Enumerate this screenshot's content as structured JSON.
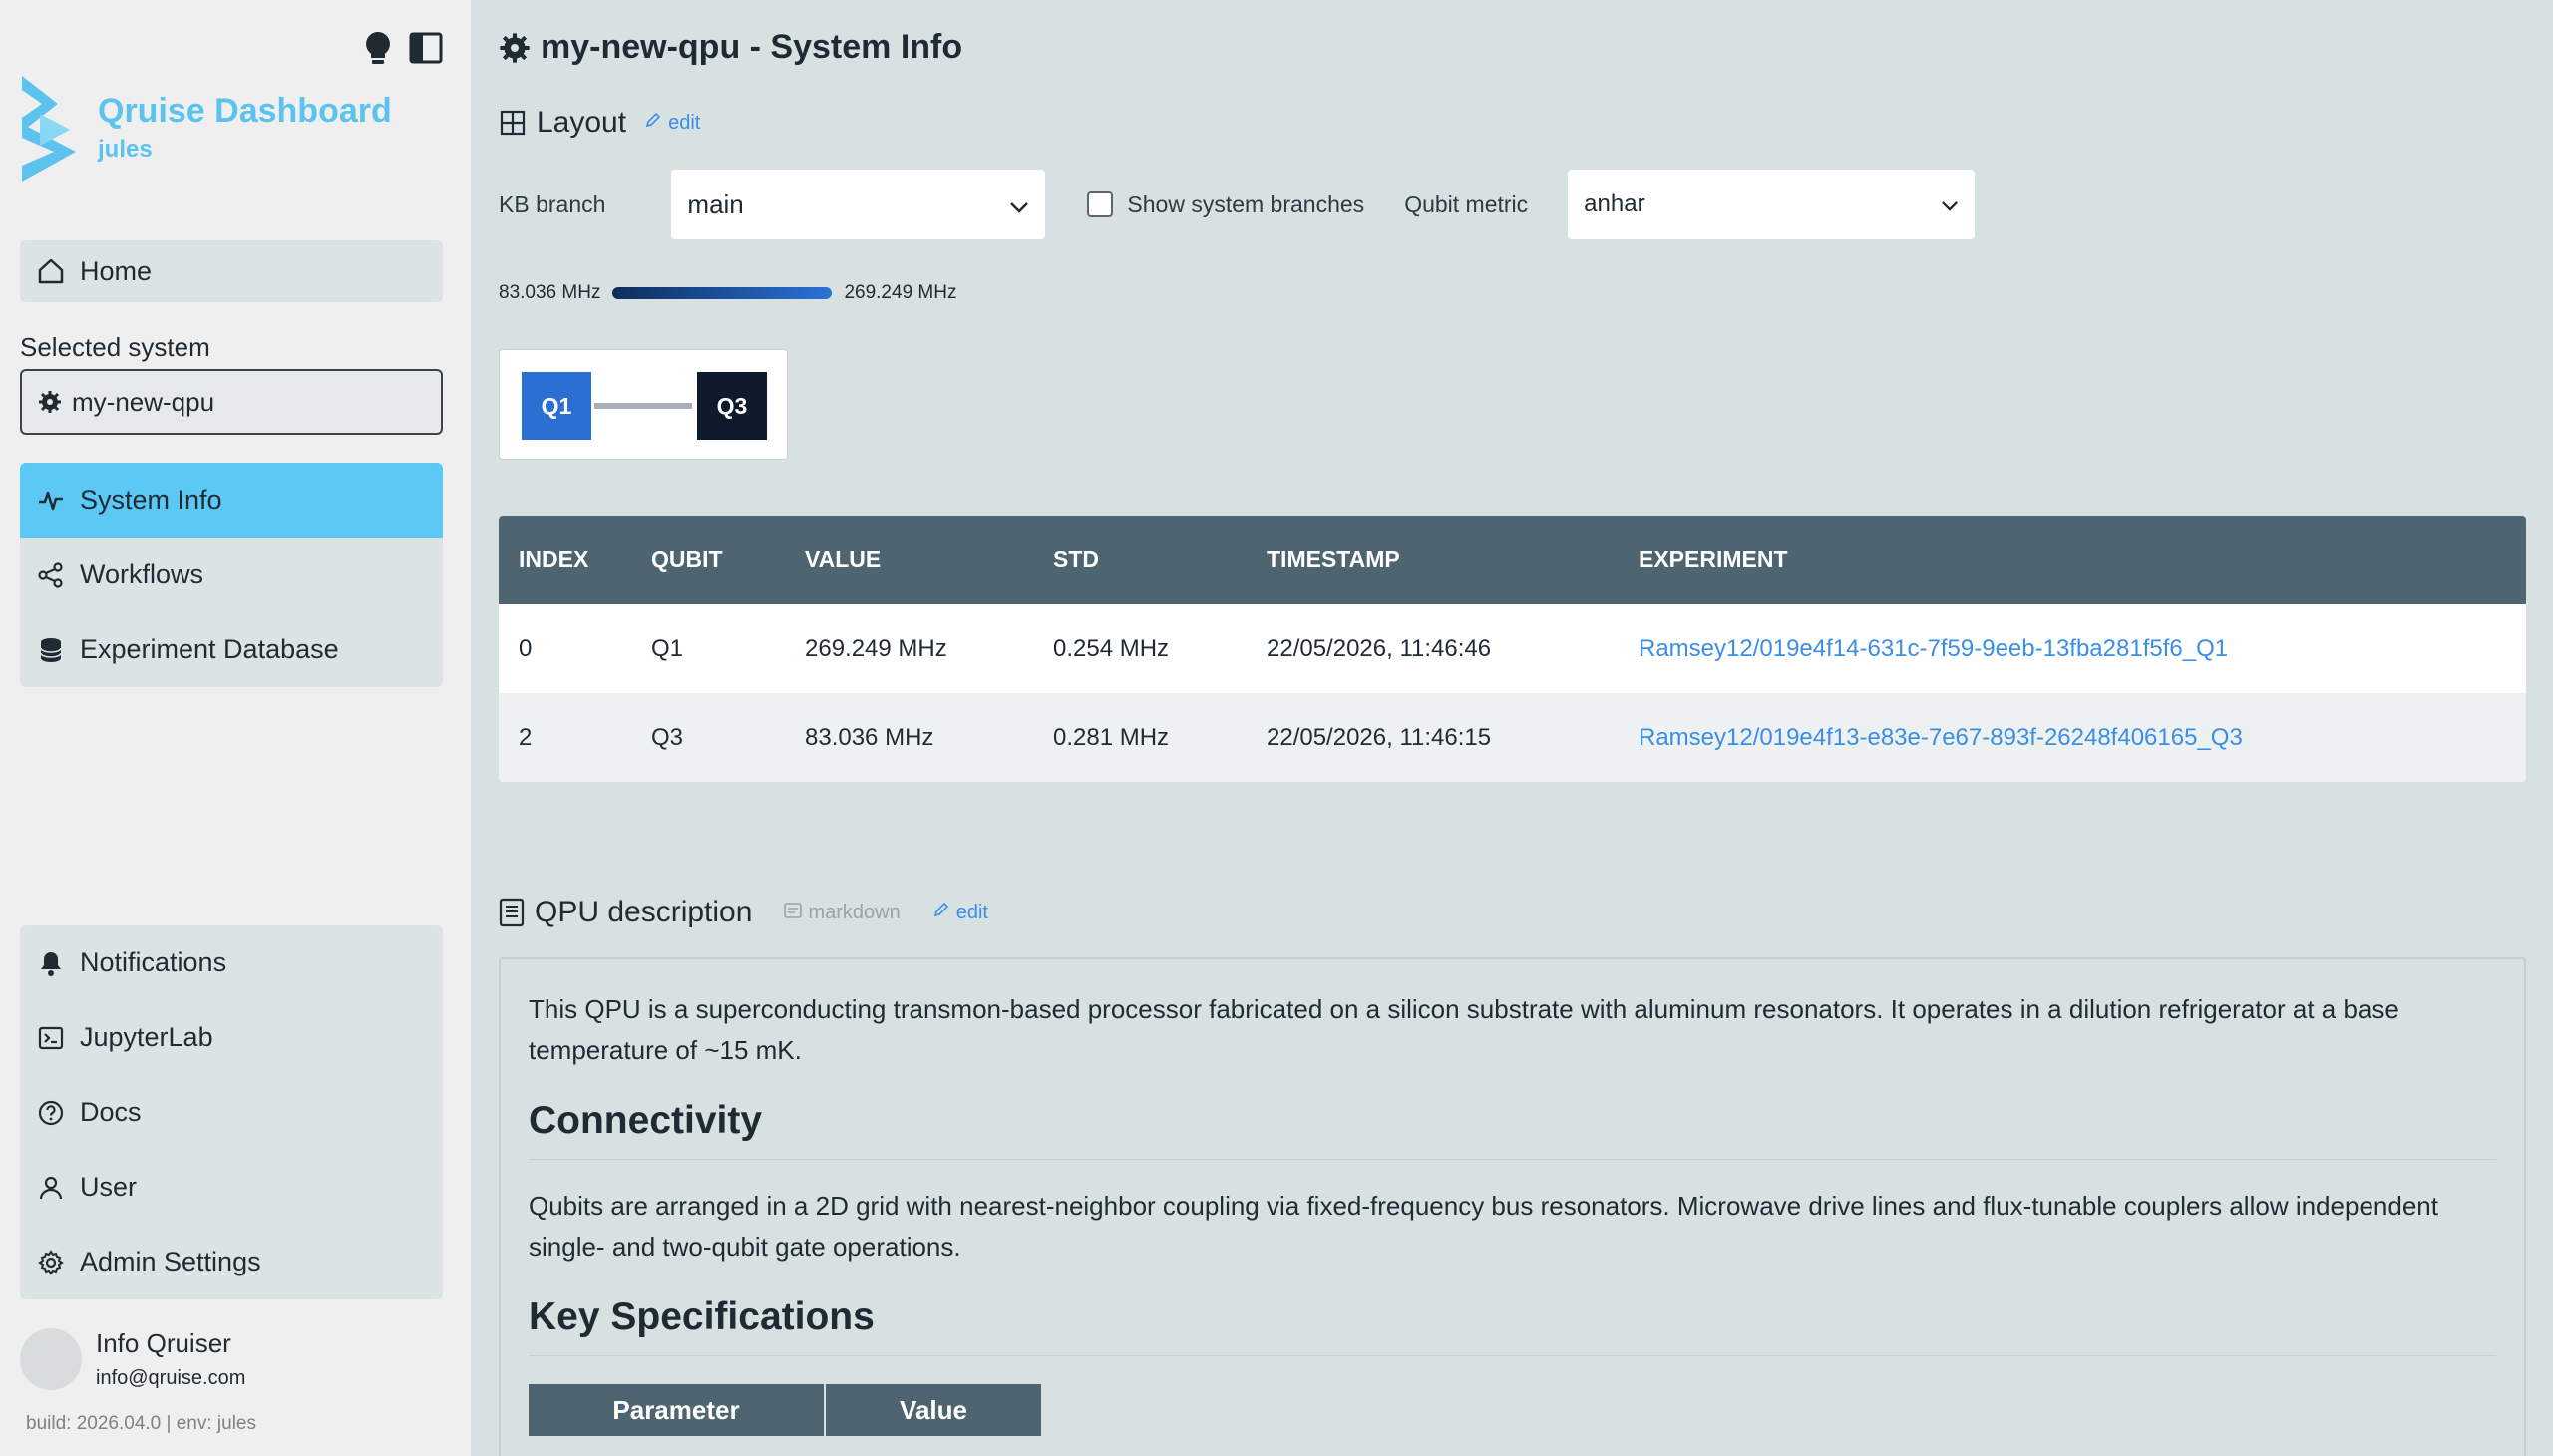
{
  "sidebar": {
    "brand_title": "Qruise Dashboard",
    "brand_sub": "jules",
    "home": "Home",
    "selected_label": "Selected system",
    "selected_value": "my-new-qpu",
    "main_nav": [
      "System Info",
      "Workflows",
      "Experiment Database"
    ],
    "bottom_nav": [
      "Notifications",
      "JupyterLab",
      "Docs",
      "User",
      "Admin Settings"
    ],
    "user_name": "Info Qruiser",
    "user_email": "info@qruise.com",
    "build": "build: 2026.04.0 | env: jules",
    "accent": "#5cc8f5"
  },
  "main": {
    "title": "my-new-qpu - System Info",
    "layout_title": "Layout",
    "edit": "edit",
    "kb_label": "KB branch",
    "kb_value": "main",
    "show_branches": "Show system branches",
    "metric_label": "Qubit metric",
    "metric_value": "anhar",
    "range_min": "83.036 MHz",
    "range_max": "269.249 MHz",
    "qubits": [
      "Q1",
      "Q3"
    ],
    "table": {
      "headers": [
        "INDEX",
        "QUBIT",
        "VALUE",
        "STD",
        "TIMESTAMP",
        "EXPERIMENT"
      ],
      "rows": [
        [
          "0",
          "Q1",
          "269.249 MHz",
          "0.254 MHz",
          "22/05/2026, 11:46:46",
          "Ramsey12/019e4f14-631c-7f59-9eeb-13fba281f5f6_Q1"
        ],
        [
          "2",
          "Q3",
          "83.036 MHz",
          "0.281 MHz",
          "22/05/2026, 11:46:15",
          "Ramsey12/019e4f13-e83e-7e67-893f-26248f406165_Q3"
        ]
      ]
    },
    "desc_title": "QPU description",
    "markdown": "markdown",
    "desc_intro": "This QPU is a superconducting transmon-based processor fabricated on a silicon substrate with aluminum resonators. It operates in a dilution refrigerator at a base temperature of ~15 mK.",
    "h_connectivity": "Connectivity",
    "connectivity_text": "Qubits are arranged in a 2D grid with nearest-neighbor coupling via fixed-frequency bus resonators. Microwave drive lines and flux-tunable couplers allow independent single- and two-qubit gate operations.",
    "h_specs": "Key Specifications",
    "spec_headers": [
      "Parameter",
      "Value"
    ]
  }
}
